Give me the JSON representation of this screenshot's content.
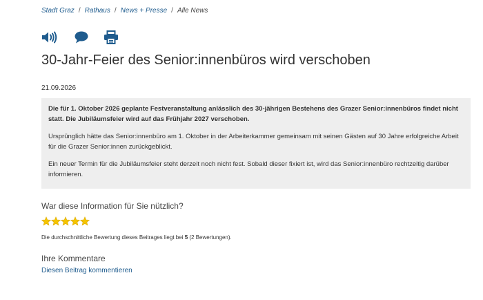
{
  "breadcrumb": {
    "items": [
      "Stadt Graz",
      "Rathaus",
      "News + Presse"
    ],
    "current": "Alle News",
    "separator": "/"
  },
  "toolbar": {
    "read_aloud_icon": "speaker-icon",
    "comment_icon": "speech-bubble-icon",
    "print_icon": "printer-icon",
    "icon_color": "#1f5c8e"
  },
  "article": {
    "title": "30-Jahr-Feier des Senior:innenbüros wird verschoben",
    "date": "21.09.2026",
    "lead": "Die für 1. Oktober 2026 geplante Festveranstaltung anlässlich des 30-jährigen Bestehens des Grazer Senior:innenbüros findet nicht statt. Die Jubiläumsfeier wird auf das Frühjahr 2027 verschoben.",
    "paragraph1": "Ursprünglich hätte das Senior:innenbüro am 1. Oktober in der Arbeiterkammer gemeinsam mit seinen Gästen auf 30 Jahre erfolgreiche Arbeit für die Grazer Senior:innen zurückgeblickt.",
    "paragraph2": "Ein neuer Termin für die Jubiläumsfeier steht derzeit noch nicht fest. Sobald dieser fixiert ist, wird das Senior:innenbüro rechtzeitig darüber informieren.",
    "box_background": "#eeeeee"
  },
  "rating": {
    "question": "War diese Information für Sie nützlich?",
    "stars_filled": 5,
    "stars_total": 5,
    "star_color": "#f5c400",
    "avg_prefix": "Die durchschnittliche Bewertung dieses Beitrages liegt bei",
    "avg_value": "5",
    "avg_suffix": "(2 Bewertungen)."
  },
  "comments": {
    "title": "Ihre Kommentare",
    "link_label": "Diesen Beitrag kommentieren"
  }
}
